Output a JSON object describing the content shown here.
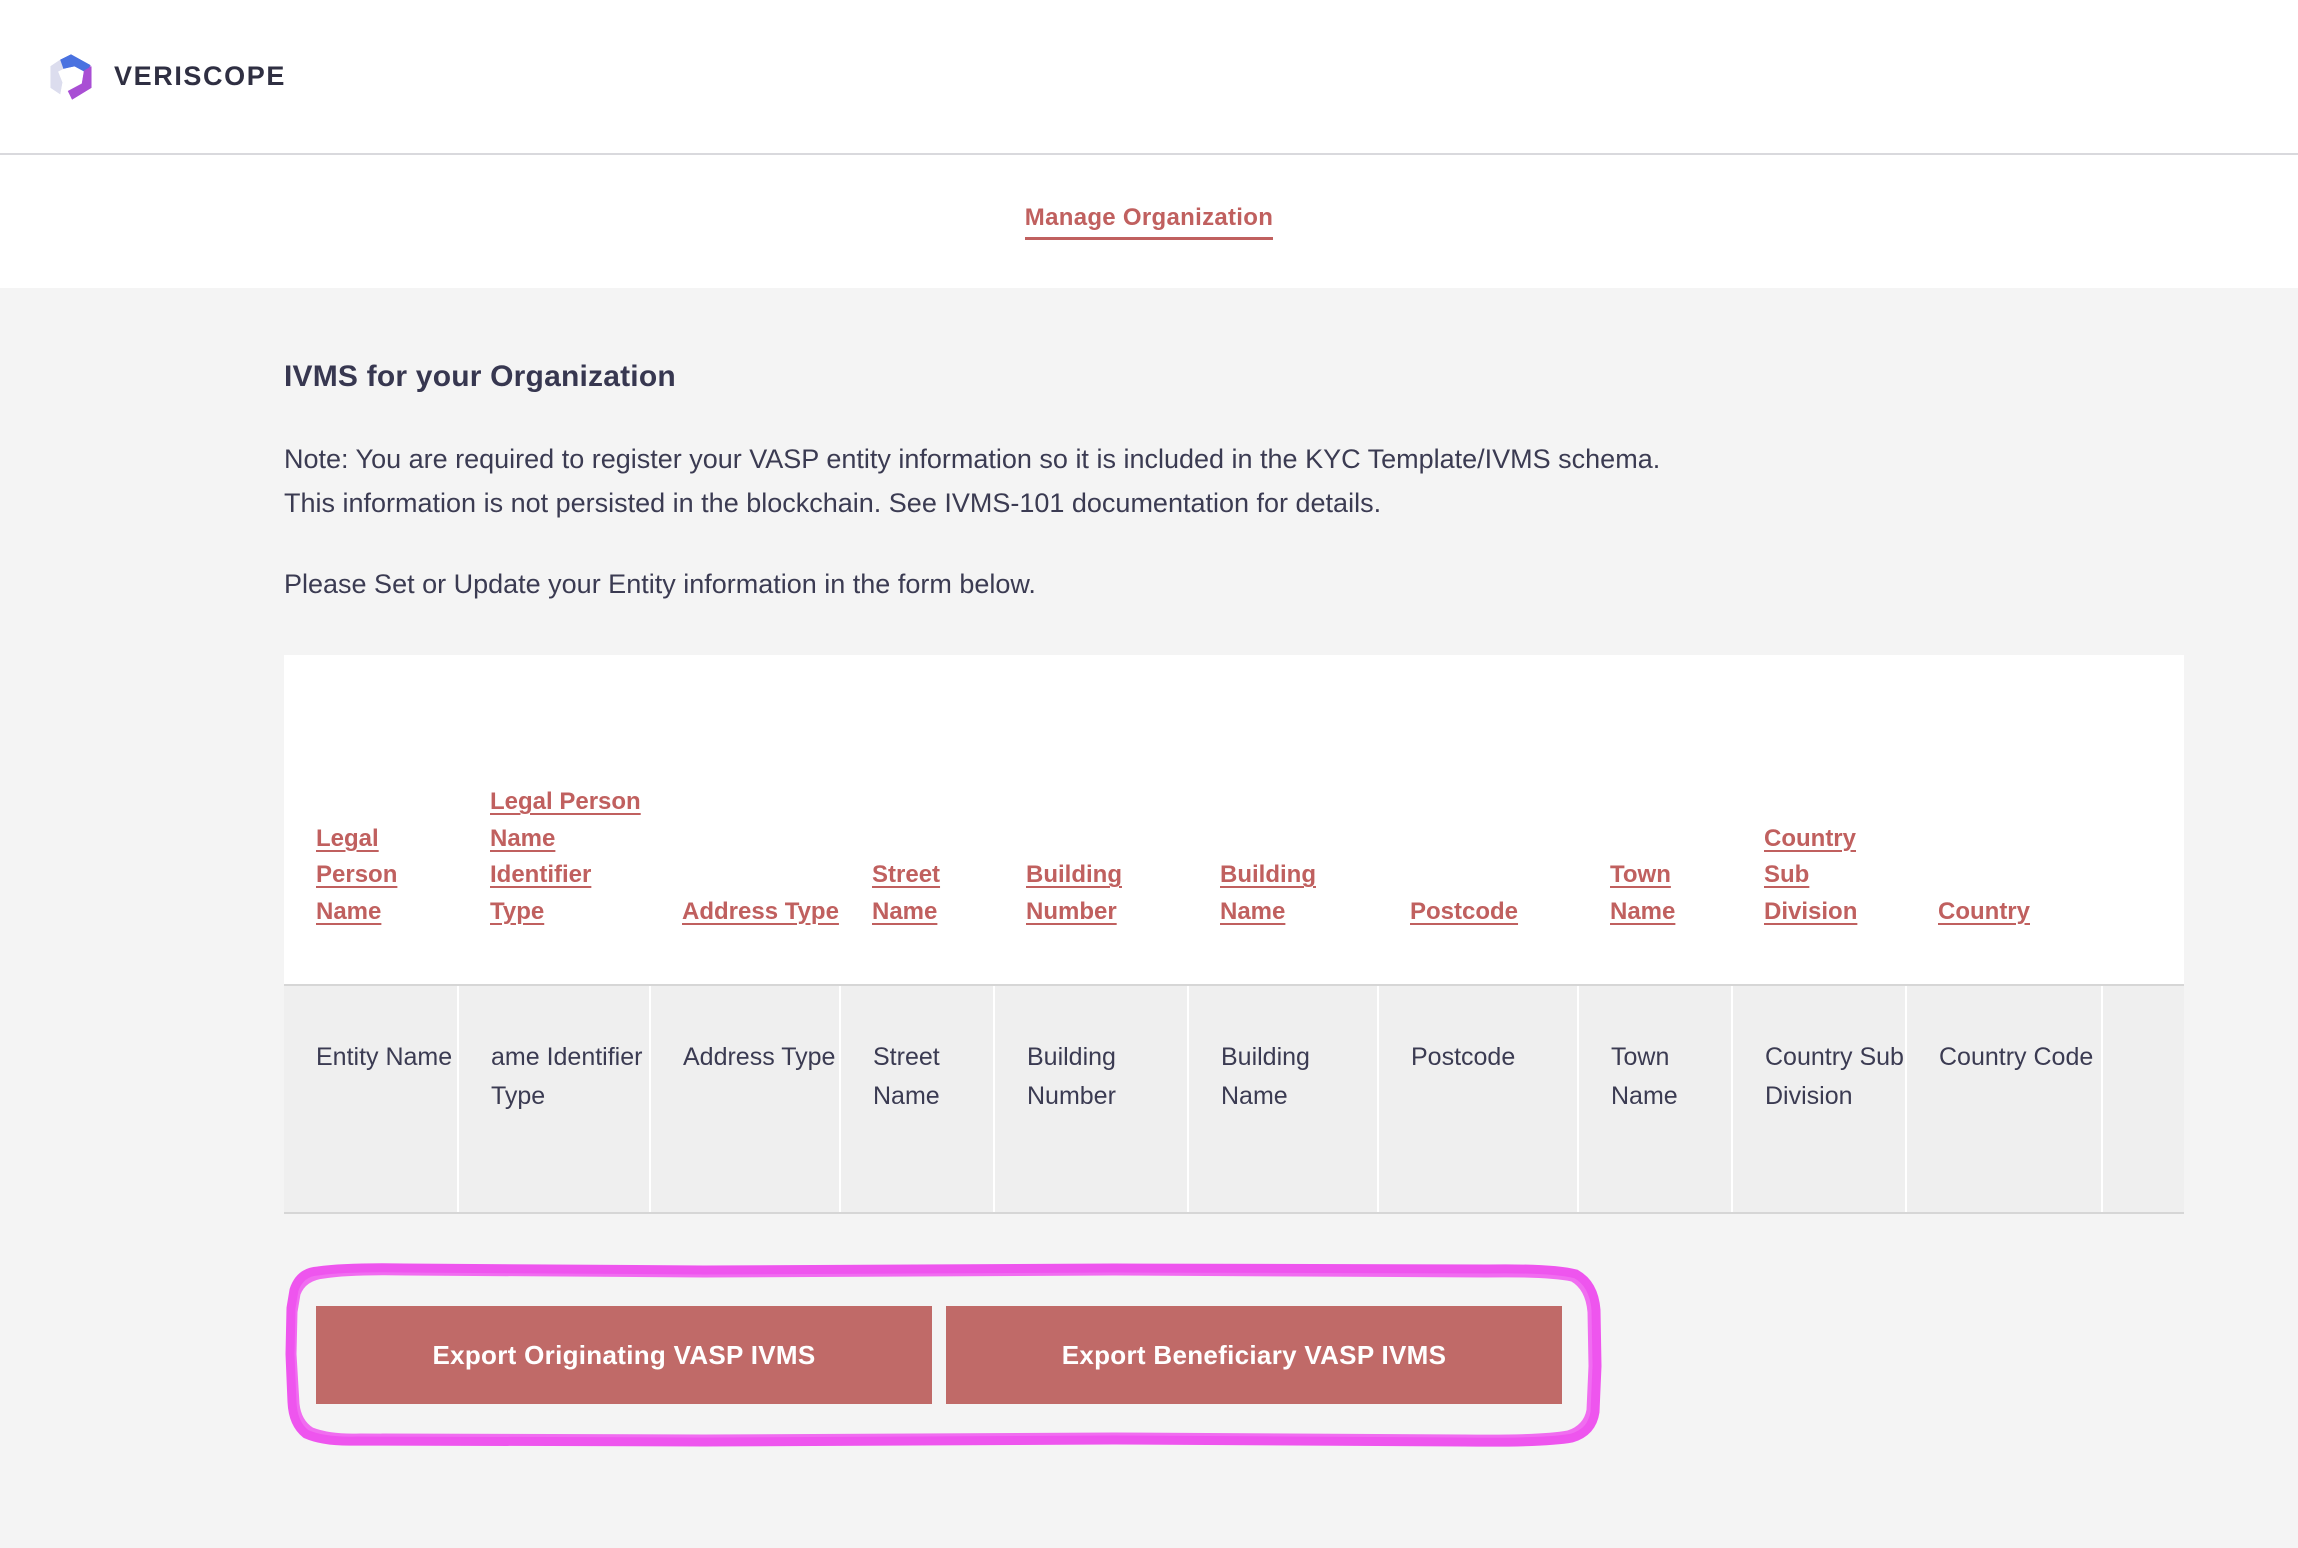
{
  "brand": {
    "logo_icon": "veriscope-hexagon-logo",
    "wordmark": "VERISCOPE",
    "logo_colors": {
      "blue": "#4a72e0",
      "purple": "#a94fd4",
      "lavender": "#dcddee"
    }
  },
  "nav": {
    "manage_organization": "Manage Organization"
  },
  "main": {
    "title": "IVMS for your Organization",
    "note_line_1": "Note: You are required to register your VASP entity information so it is included in the KYC Template/IVMS schema.",
    "note_line_2": "This information is not persisted in the blockchain. See IVMS-101 documentation for details.",
    "instruction": "Please Set or Update your Entity information in the form below."
  },
  "table": {
    "headers": [
      "Legal Person Name",
      "Legal Person Name Identifier Type",
      "Address Type",
      "Street Name",
      "Building Number",
      "Building Name",
      "Postcode",
      "Town Name",
      "Country Sub Division",
      "Country",
      ""
    ],
    "rows": [
      [
        "Entity Name",
        "ame Identifier Type",
        "Address Type",
        "Street Name",
        "Building Number",
        "Building Name",
        "Postcode",
        "Town Name",
        "Country Sub Division",
        "Country Code",
        ""
      ]
    ]
  },
  "actions": {
    "export_originating": "Export Originating VASP IVMS",
    "export_beneficiary": "Export Beneficiary VASP IVMS"
  },
  "annotation": {
    "type": "highlight-rectangle",
    "color": "#ee55ee",
    "target": "export-buttons-group"
  },
  "colors": {
    "accent_rose": "#c0605f",
    "button_rose": "#c06a68",
    "text_dark": "#3b3b52",
    "page_bg": "#f4f4f4",
    "cell_bg": "#efefef"
  }
}
